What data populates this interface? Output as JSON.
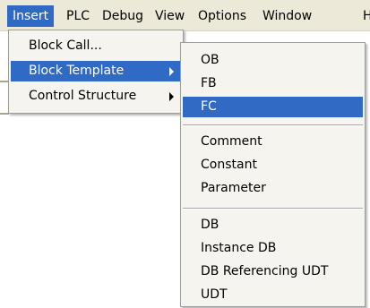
{
  "menubar": {
    "items": [
      {
        "label": "Insert",
        "active": true
      },
      {
        "label": "PLC"
      },
      {
        "label": "Debug"
      },
      {
        "label": "View"
      },
      {
        "label": "Options"
      },
      {
        "label": "Window"
      },
      {
        "label": "H"
      }
    ]
  },
  "insert_menu": {
    "items": [
      {
        "label": "Block Call..."
      },
      {
        "label": "Block Template",
        "has_submenu": true,
        "highlighted": true
      },
      {
        "label": "Control Structure",
        "has_submenu": true
      }
    ]
  },
  "block_template_menu": {
    "items": [
      {
        "label": "OB"
      },
      {
        "label": "FB"
      },
      {
        "label": "FC",
        "highlighted": true
      },
      {
        "label": "Comment"
      },
      {
        "label": "Constant"
      },
      {
        "label": "Parameter"
      },
      {
        "label": "DB"
      },
      {
        "label": "Instance DB"
      },
      {
        "label": "DB Referencing UDT"
      },
      {
        "label": "UDT"
      }
    ]
  },
  "colors": {
    "highlight": "#316ac5",
    "menu_background": "#f5f4ef",
    "menubar_background": "#ece9d8"
  }
}
